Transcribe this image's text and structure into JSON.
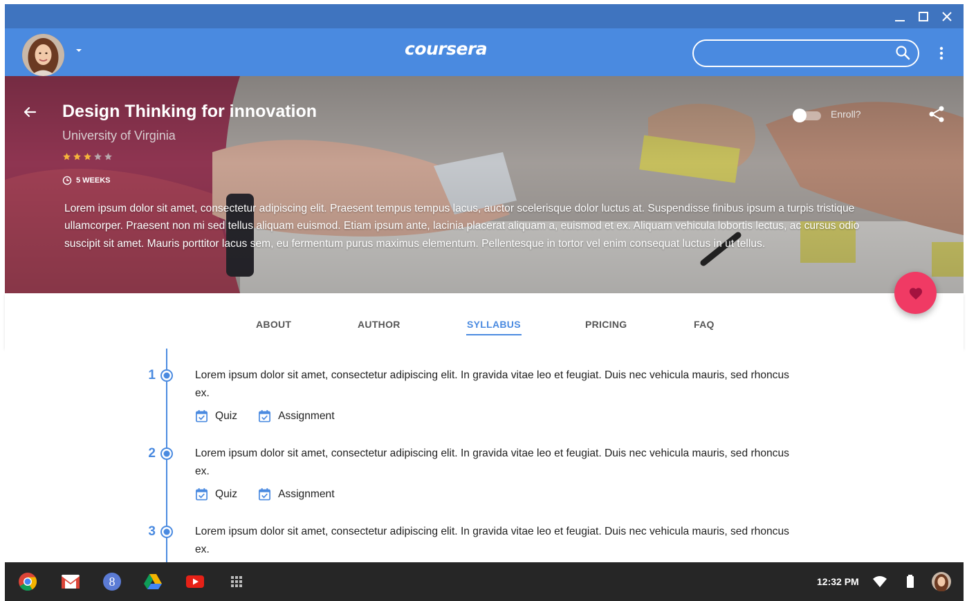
{
  "window": {
    "controls": [
      "minimize",
      "maximize",
      "close"
    ]
  },
  "appbar": {
    "logo_text": "coursera",
    "search_placeholder": "",
    "icons": [
      "avatar",
      "chevron-down-icon",
      "search-icon",
      "more-vert-icon"
    ]
  },
  "course": {
    "title": "Design Thinking for innovation",
    "university": "University of Virginia",
    "rating": 3,
    "rating_max": 5,
    "duration": "5 WEEKS",
    "description": "Lorem ipsum dolor sit amet, consectetur adipiscing elit. Praesent tempus tempus lacus, auctor scelerisque dolor luctus at. Suspendisse finibus ipsum a turpis tristique ullamcorper. Praesent non mi sed tellus aliquam euismod. Etiam ipsum ante, lacinia placerat aliquam a, euismod et ex. Aliquam vehicula lobortis lectus, ac cursus odio suscipit sit amet. Mauris porttitor lacus sem, eu fermentum purus maximus elementum. Pellentesque in tortor vel enim consequat luctus in ut tellus.",
    "enroll_label": "Enroll?",
    "enrolled": false
  },
  "tabs": [
    {
      "label": "ABOUT",
      "active": false
    },
    {
      "label": "AUTHOR",
      "active": false
    },
    {
      "label": "SYLLABUS",
      "active": true
    },
    {
      "label": "PRICING",
      "active": false
    },
    {
      "label": "FAQ",
      "active": false
    }
  ],
  "syllabus": [
    {
      "number": "1",
      "text": "Lorem ipsum dolor sit amet, consectetur adipiscing elit. In gravida vitae leo et feugiat. Duis nec vehicula mauris, sed rhoncus ex.",
      "tags": [
        "Quiz",
        "Assignment"
      ]
    },
    {
      "number": "2",
      "text": "Lorem ipsum dolor sit amet, consectetur adipiscing elit. In gravida vitae leo et feugiat. Duis nec vehicula mauris, sed rhoncus ex.",
      "tags": [
        "Quiz",
        "Assignment"
      ]
    },
    {
      "number": "3",
      "text": "Lorem ipsum dolor sit amet, consectetur adipiscing elit. In gravida vitae leo et feugiat. Duis nec vehicula mauris, sed rhoncus ex.",
      "tags": []
    }
  ],
  "shelf": {
    "apps": [
      "chrome-icon",
      "gmail-icon",
      "google-plus-icon",
      "drive-icon",
      "youtube-icon",
      "app-launcher-icon"
    ],
    "time": "12:32 PM",
    "tray": [
      "wifi-icon",
      "battery-icon",
      "avatar"
    ]
  },
  "colors": {
    "primary": "#4a8ae0",
    "titlebar": "#3f74bf",
    "accent": "#f03a64",
    "shelf": "#262626"
  }
}
